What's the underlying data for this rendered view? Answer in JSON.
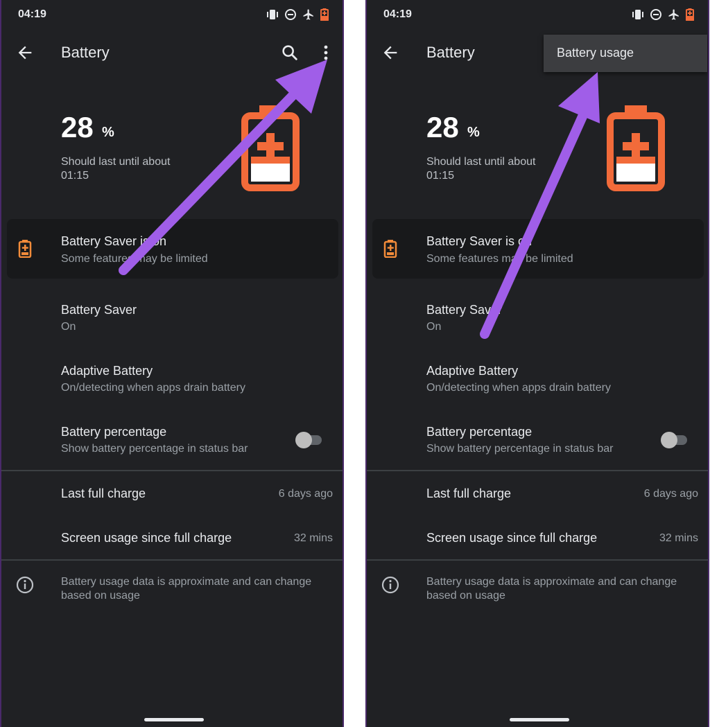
{
  "status_bar": {
    "time": "04:19"
  },
  "toolbar": {
    "title": "Battery"
  },
  "battery": {
    "level": "28",
    "unit": "%",
    "estimate_line1": "Should last until about",
    "estimate_line2": "01:15"
  },
  "saver_card": {
    "title": "Battery Saver is on",
    "subtitle": "Some features may be limited"
  },
  "settings": [
    {
      "title": "Battery Saver",
      "subtitle": "On"
    },
    {
      "title": "Adaptive Battery",
      "subtitle": "On/detecting when apps drain battery"
    },
    {
      "title": "Battery percentage",
      "subtitle": "Show battery percentage in status bar",
      "toggle": false
    }
  ],
  "stats": [
    {
      "label": "Last full charge",
      "value": "6 days ago"
    },
    {
      "label": "Screen usage since full charge",
      "value": "32 mins"
    }
  ],
  "info_text": "Battery usage data is approximate and can change based on usage",
  "overflow_menu": {
    "items": [
      "Battery usage"
    ]
  },
  "colors": {
    "background": "#202124",
    "battery_accent": "#f26b3a",
    "annotation_arrow": "#a05ee8",
    "menu_background": "#3c3d40"
  }
}
